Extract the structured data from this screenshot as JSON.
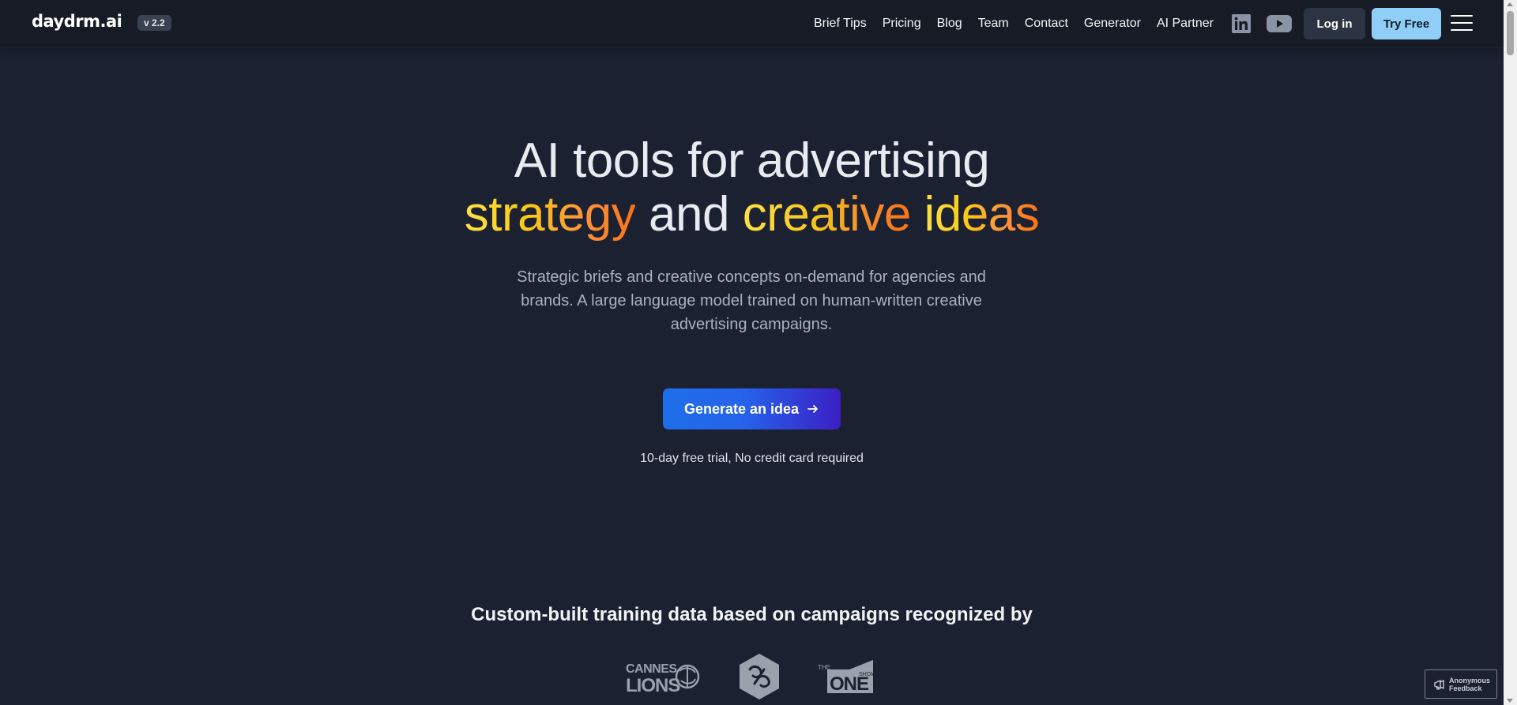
{
  "header": {
    "logo": "daydrm.ai",
    "version": "v 2.2",
    "nav": [
      "Brief Tips",
      "Pricing",
      "Blog",
      "Team",
      "Contact",
      "Generator",
      "AI Partner"
    ],
    "social": [
      "linkedin-icon",
      "youtube-icon"
    ],
    "login_label": "Log in",
    "try_label": "Try Free"
  },
  "hero": {
    "line1": "AI tools for advertising",
    "line2_word1": "strategy",
    "line2_word2": "and",
    "line2_word3": "creative",
    "line2_word4": "ideas",
    "subtitle": "Strategic briefs and creative concepts on-demand for agencies and brands. A large language model trained on human-written creative advertising campaigns.",
    "cta_label": "Generate an idea",
    "trial_note": "10-day free trial, No credit card required"
  },
  "recognition": {
    "title": "Custom-built training data based on campaigns recognized by",
    "logos": [
      "cannes-lions-logo",
      "dad-logo",
      "one-show-logo"
    ],
    "cannes_line1": "CANNES",
    "cannes_line2": "LIONS",
    "oneshow_the": "THE",
    "oneshow_one": "ONE",
    "oneshow_show": "SHOW"
  },
  "feedback": {
    "line1": "Anonymous",
    "line2": "Feedback"
  },
  "colors": {
    "background": "#1b2130",
    "header": "#161b26",
    "accent_yellow": "#fde047",
    "accent_orange": "#f97316",
    "cta_blue": "#2563eb",
    "try_button": "#8fcff7"
  }
}
